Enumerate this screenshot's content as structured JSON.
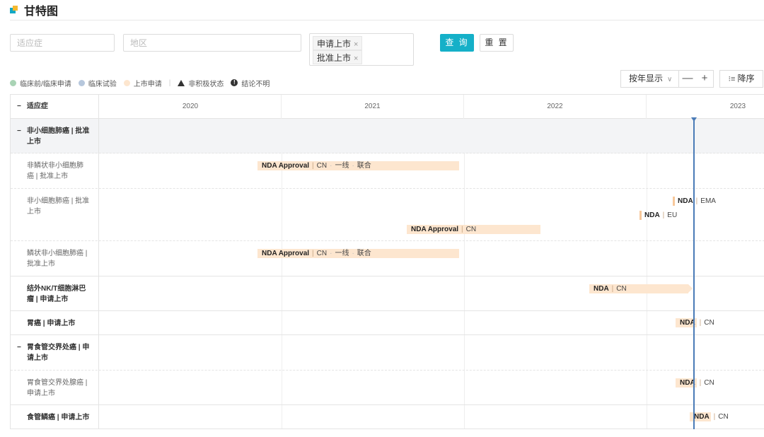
{
  "page": {
    "title": "甘特图"
  },
  "filters": {
    "indication_placeholder": "适应症",
    "region_placeholder": "地区",
    "tags": [
      {
        "label": "申请上市"
      },
      {
        "label": "批准上市"
      }
    ],
    "query_label": "查 询",
    "reset_label": "重 置"
  },
  "legend": {
    "items": [
      {
        "label": "临床前/临床申请",
        "color": "#a9d3b5"
      },
      {
        "label": "临床试验",
        "color": "#b6c7dc"
      },
      {
        "label": "上市申请",
        "color": "#fde6cf"
      }
    ],
    "separator": "|",
    "inactive_label": "非积极状态",
    "unclear_label": "结论不明",
    "unclear_glyph": "!"
  },
  "controls": {
    "view_mode": "按年显示",
    "zoom_out": "—",
    "zoom_in": "+",
    "sort_label": "降序"
  },
  "gantt": {
    "column_header": "适应症",
    "collapse_glyph": "−",
    "years": [
      "2020",
      "2021",
      "2022",
      "2023"
    ],
    "rows": [
      {
        "label": "非小细胞肺癌 | 批准上市",
        "bars": []
      },
      {
        "label": "非鳞状非小细胞肺癌 | 批准上市",
        "bars": [
          {
            "phase": "NDA Approval",
            "region": "CN",
            "line": "一线",
            "combo": "联合"
          }
        ]
      },
      {
        "label": "非小细胞肺癌 | 批准上市",
        "bars": [
          {
            "phase": "NDA",
            "region": "EMA"
          },
          {
            "phase": "NDA",
            "region": "EU"
          },
          {
            "phase": "NDA Approval",
            "region": "CN"
          }
        ]
      },
      {
        "label": "鳞状非小细胞肺癌 | 批准上市",
        "bars": [
          {
            "phase": "NDA Approval",
            "region": "CN",
            "line": "一线",
            "combo": "联合"
          }
        ]
      },
      {
        "label": "结外NK/T细胞淋巴瘤 | 申请上市",
        "bars": [
          {
            "phase": "NDA",
            "region": "CN"
          }
        ]
      },
      {
        "label": "胃癌 | 申请上市",
        "bars": [
          {
            "phase": "NDA",
            "region": "CN"
          }
        ]
      },
      {
        "label": "胃食管交界处癌 | 申请上市",
        "bars": []
      },
      {
        "label": "胃食管交界处腺癌 | 申请上市",
        "bars": [
          {
            "phase": "NDA",
            "region": "CN"
          }
        ]
      },
      {
        "label": "食管鳞癌 | 申请上市",
        "bars": [
          {
            "phase": "NDA",
            "region": "CN"
          }
        ]
      }
    ]
  },
  "colors": {
    "accent": "#15b0c8",
    "bar_fill": "#fde6cf",
    "today_line": "#4a7bb7"
  }
}
